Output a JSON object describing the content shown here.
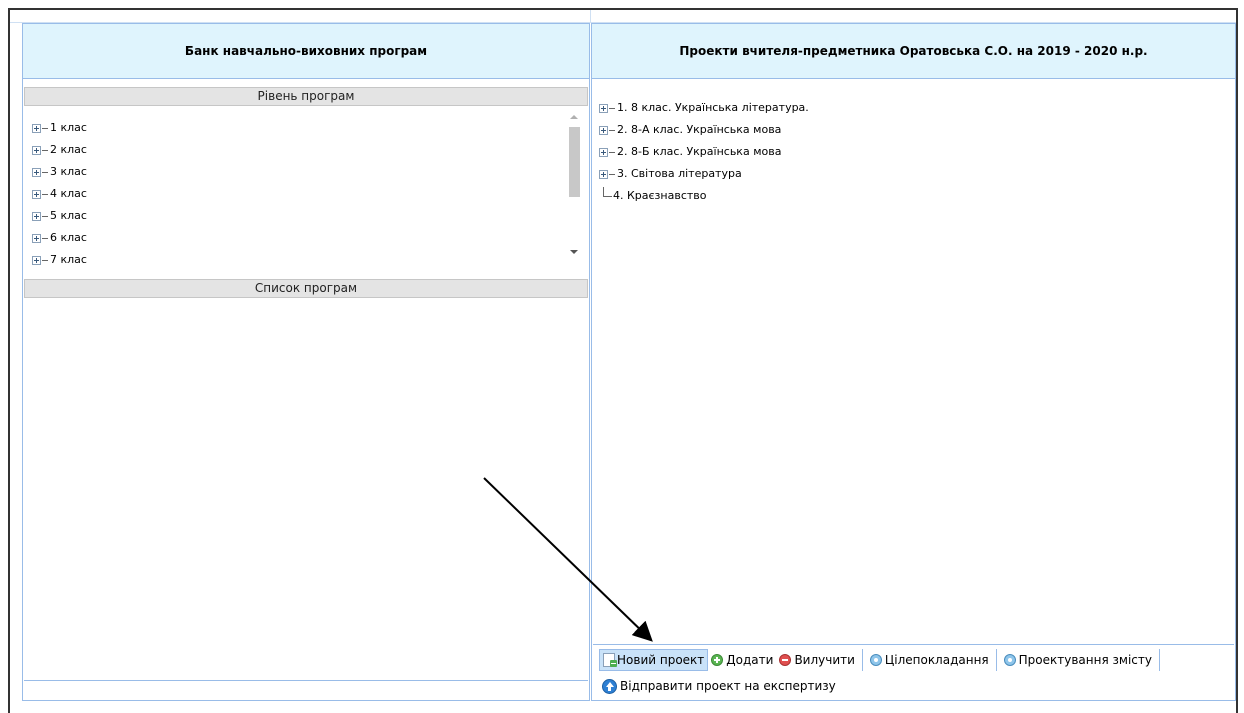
{
  "left_panel": {
    "title": "Банк навчально-виховних програм",
    "levels_header": "Рівень програм",
    "levels": [
      {
        "label": "1 клас"
      },
      {
        "label": "2 клас"
      },
      {
        "label": "3 клас"
      },
      {
        "label": "4 клас"
      },
      {
        "label": "5 клас"
      },
      {
        "label": "6 клас"
      },
      {
        "label": "7 клас"
      }
    ],
    "list_header": "Список програм"
  },
  "right_panel": {
    "title": "Проекти вчителя-предметника Оратовська С.О. на 2019 - 2020 н.р.",
    "projects": [
      {
        "label": "1. 8 клас. Українська література.",
        "expandable": true
      },
      {
        "label": "2. 8-А клас. Українська мова",
        "expandable": true
      },
      {
        "label": "2. 8-Б клас. Українська мова",
        "expandable": true
      },
      {
        "label": "3. Світова література",
        "expandable": true
      },
      {
        "label": "4. Краєзнавство",
        "expandable": false
      }
    ]
  },
  "toolbar": {
    "new_project": "Новий проект",
    "add": "Додати",
    "remove": "Вилучити",
    "goal_setting": "Цілепокладання",
    "content_design": "Проектування змісту",
    "send_for_review": "Відправити проект на експертизу"
  },
  "icons": {
    "new_project": "new-document-icon",
    "add": "add-circle-icon",
    "remove": "remove-circle-icon",
    "goal_setting": "gear-icon",
    "content_design": "gear-icon",
    "send_for_review": "upload-arrow-icon"
  },
  "colors": {
    "header_bg": "#dff4fd",
    "panel_border": "#99bce8",
    "selected_button_bg": "#c9e2f8"
  }
}
